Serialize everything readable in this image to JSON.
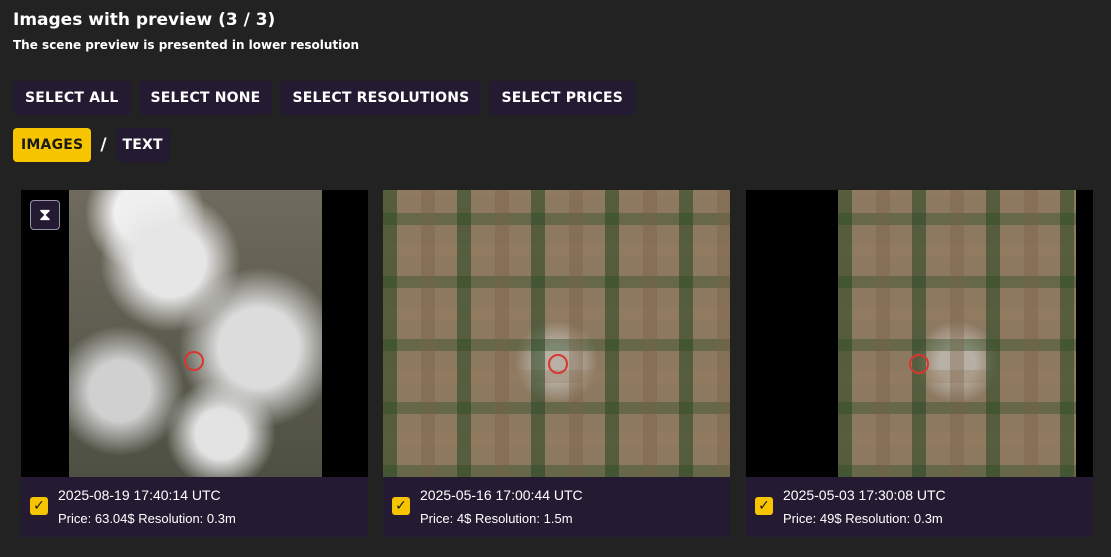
{
  "header": {
    "title": "Images with preview (3 / 3)",
    "subtitle": "The scene preview is presented in lower resolution"
  },
  "selection_buttons": [
    "SELECT ALL",
    "SELECT NONE",
    "SELECT RESOLUTIONS",
    "SELECT PRICES"
  ],
  "view_toggle": {
    "images_label": "IMAGES",
    "separator": "/",
    "text_label": "TEXT",
    "active": "IMAGES"
  },
  "accent_color": "#f7c500",
  "cards": [
    {
      "datetime": "2025-08-19 17:40:14 UTC",
      "price_label": "Price:",
      "price": "63.04$",
      "resolution_label": "Resolution:",
      "resolution": "0.3m",
      "checked": true,
      "preview": "cloudy",
      "status_icon": "hourglass-icon"
    },
    {
      "datetime": "2025-05-16 17:00:44 UTC",
      "price_label": "Price:",
      "price": "4$",
      "resolution_label": "Resolution:",
      "resolution": "1.5m",
      "checked": true,
      "preview": "farmland"
    },
    {
      "datetime": "2025-05-03 17:30:08 UTC",
      "price_label": "Price:",
      "price": "49$",
      "resolution_label": "Resolution:",
      "resolution": "0.3m",
      "checked": true,
      "preview": "farmland"
    }
  ]
}
